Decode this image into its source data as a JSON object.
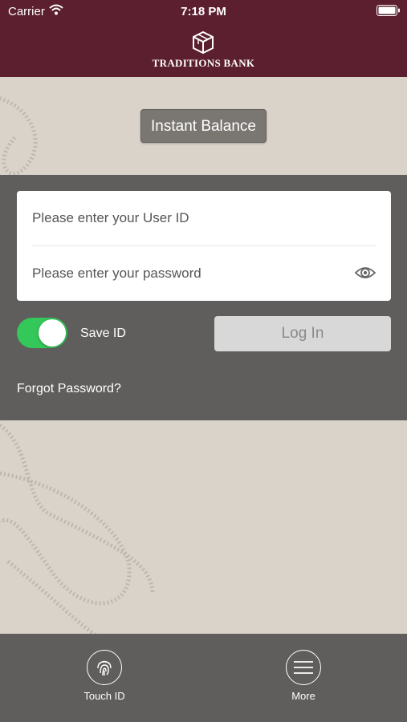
{
  "status_bar": {
    "carrier": "Carrier",
    "time": "7:18 PM"
  },
  "header": {
    "bank_name": "TRADITIONS BANK",
    "brand_color": "#5b1f2f"
  },
  "instant_balance": {
    "label": "Instant Balance"
  },
  "login": {
    "user_id_placeholder": "Please enter your User ID",
    "password_placeholder": "Please enter your password",
    "save_id_label": "Save ID",
    "save_id_on": true,
    "login_label": "Log In",
    "forgot_password": "Forgot Password?"
  },
  "tab_bar": {
    "items": [
      {
        "label": "Touch ID",
        "icon": "fingerprint-icon"
      },
      {
        "label": "More",
        "icon": "hamburger-menu-icon"
      }
    ]
  },
  "colors": {
    "accent_toggle": "#34c759",
    "panel": "#5f5e5c",
    "background": "#d9d3ca"
  }
}
